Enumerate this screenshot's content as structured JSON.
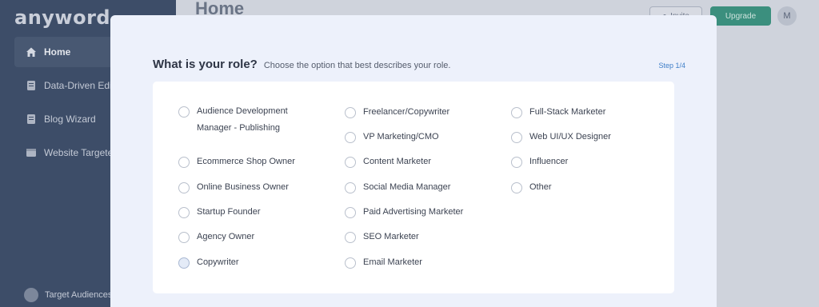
{
  "app": {
    "logo": "anyword"
  },
  "sidebar": {
    "items": [
      {
        "label": "Home",
        "icon": "home-icon"
      },
      {
        "label": "Data-Driven Editor",
        "icon": "document-icon"
      },
      {
        "label": "Blog Wizard",
        "icon": "document-icon"
      },
      {
        "label": "Website Targeted",
        "icon": "browser-icon"
      }
    ],
    "bottom": {
      "label": "Target Audiences"
    }
  },
  "header": {
    "title": "Home",
    "invite_label": "Invite",
    "upgrade_label": "Upgrade",
    "avatar_initial": "M"
  },
  "modal": {
    "title": "What is your role?",
    "subtitle": "Choose the option that best describes your role.",
    "step": "Step 1/4",
    "columns": [
      [
        "Audience Development Manager - Publishing",
        "Ecommerce Shop Owner",
        "Online Business Owner",
        "Startup Founder",
        "Agency Owner",
        "Copywriter"
      ],
      [
        "Freelancer/Copywriter",
        "VP Marketing/CMO",
        "Content Marketer",
        "Social Media Manager",
        "Paid Advertising Marketer",
        "SEO Marketer",
        "Email Marketer"
      ],
      [
        "Full-Stack Marketer",
        "Web UI/UX Designer",
        "Influencer",
        "Other"
      ]
    ]
  },
  "colors": {
    "accent": "#3f7fc8",
    "upgrade": "#3b8f7e",
    "sidebar": "#3d4d68"
  }
}
